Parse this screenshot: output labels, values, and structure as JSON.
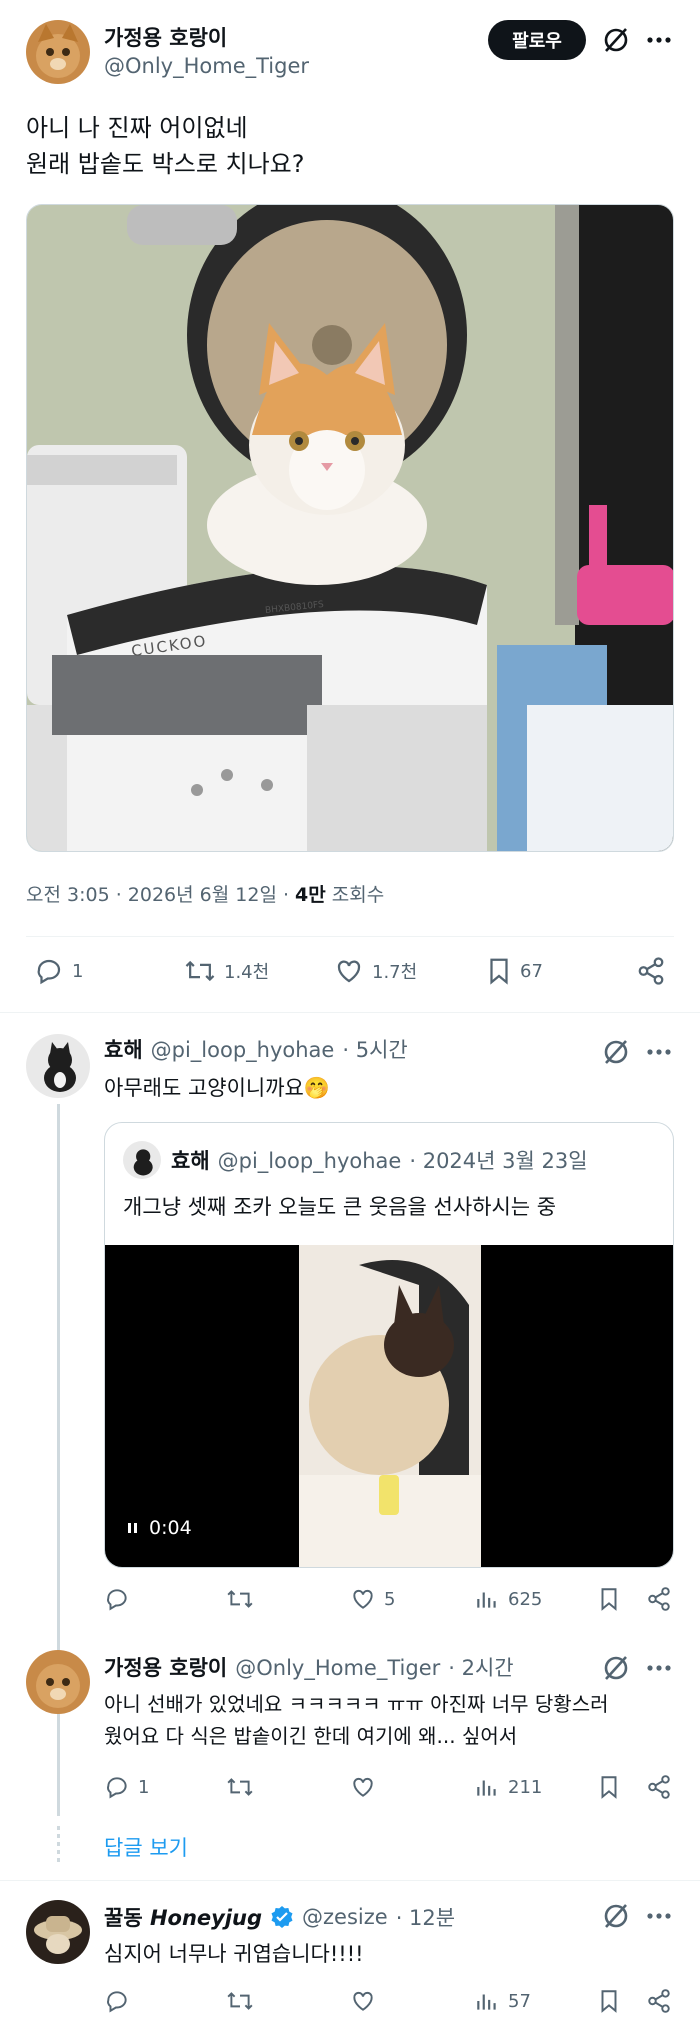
{
  "main_tweet": {
    "display_name": "가정용 호랑이",
    "handle": "@Only_Home_Tiger",
    "follow_label": "팔로우",
    "text_line1": "아니 나 진짜 어이없네",
    "text_line2": "원래 밥솥도 박스로 치나요?",
    "image_brand": "CUCKOO",
    "image_model": "BHXB0810FS",
    "timestamp": "오전 3:05 · 2026년 6월 12일 · ",
    "views_count": "4만",
    "views_label": " 조회수",
    "replies": "1",
    "retweets": "1.4천",
    "likes": "1.7천",
    "bookmarks": "67"
  },
  "reply1": {
    "display_name": "효해",
    "handle": "@pi_loop_hyohae",
    "time": "· 5시간",
    "text": "아무래도 고양이니까요🤭",
    "quote": {
      "display_name": "효해",
      "handle": "@pi_loop_hyohae",
      "date": "· 2024년 3월 23일",
      "text": "개그냥 셋째 조카 오늘도 큰 웃음을 선사하시는 중",
      "video_time": "0:04"
    },
    "likes": "5",
    "views": "625"
  },
  "reply2": {
    "display_name": "가정용 호랑이",
    "handle": "@Only_Home_Tiger",
    "time": "· 2시간",
    "text_line1": "아니  선배가 있었네요 ㅋㅋㅋㅋㅋ ㅠㅠ 아진짜 너무 당황스러",
    "text_line2": "웠어요 다 식은 밥솥이긴 한데 여기에 왜... 싶어서",
    "replies": "1",
    "views": "211"
  },
  "show_replies_label": "답글 보기",
  "reply3": {
    "display_name_kr": "꿀동",
    "display_name_en": "Honeyjug",
    "handle": "@zesize",
    "time": "· 12분",
    "text": "심지어 너무나 귀엽습니다!!!!",
    "views": "57"
  },
  "colors": {
    "accent": "#1d9bf0",
    "text": "#0f1419",
    "muted": "#536471",
    "follow_bg": "#0f1419"
  }
}
